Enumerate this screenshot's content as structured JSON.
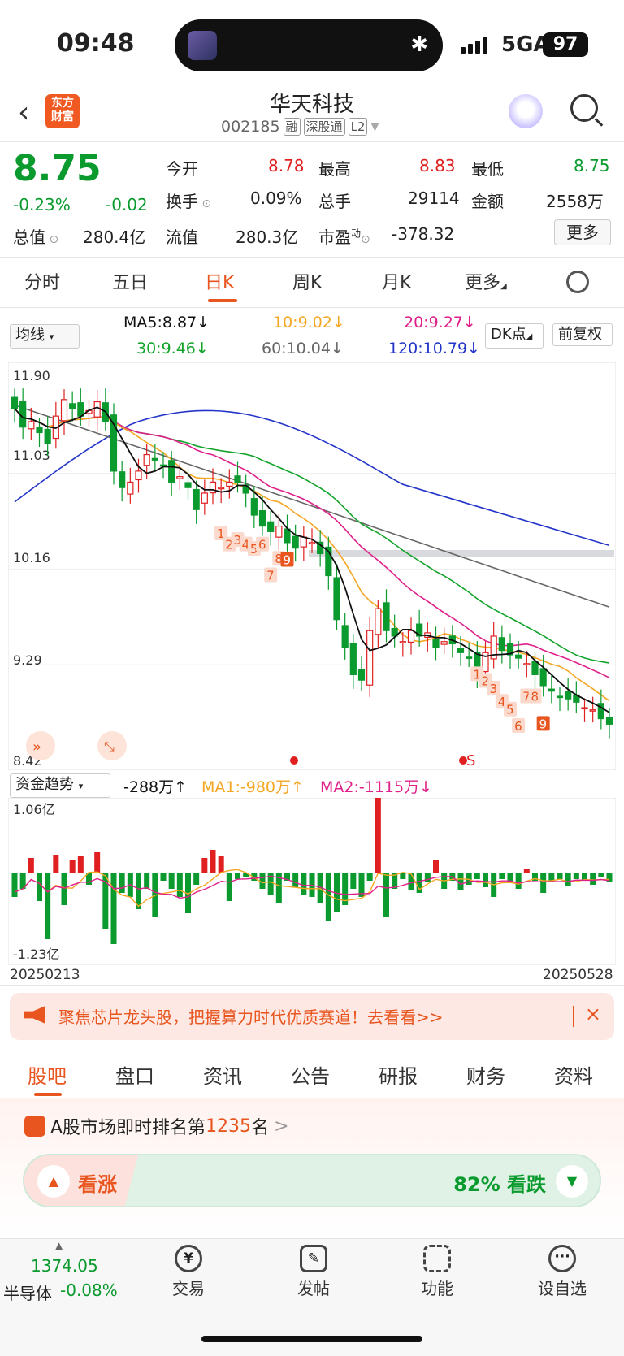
{
  "status": {
    "time": "09:48",
    "network": "5GA",
    "battery": "97",
    "bluetooth_icon": "bluetooth-icon"
  },
  "header": {
    "app_logo": "东方财富",
    "title": "华天科技",
    "code": "002185",
    "tags": [
      "融",
      "深股通",
      "L2"
    ]
  },
  "quote": {
    "price": "8.75",
    "change_pct": "-0.23%",
    "change": "-0.02",
    "open_label": "今开",
    "open": "8.78",
    "high_label": "最高",
    "high": "8.83",
    "low_label": "最低",
    "low": "8.75",
    "turnover_label": "换手",
    "turnover": "0.09%",
    "volume_label": "总手",
    "volume": "29114",
    "amount_label": "金额",
    "amount": "2558万",
    "mktcap_label": "总值",
    "mktcap": "280.4亿",
    "float_label": "流值",
    "float": "280.3亿",
    "pe_label": "市盈",
    "pe_sup": "动",
    "pe": "-378.32",
    "more": "更多"
  },
  "period_tabs": [
    "分时",
    "五日",
    "日K",
    "周K",
    "月K",
    "更多"
  ],
  "ma": {
    "selector": "均线",
    "ma5": "MA5:8.87↓",
    "ma10": "10:9.02↓",
    "ma20": "20:9.27↓",
    "ma30": "30:9.46↓",
    "ma60": "60:10.04↓",
    "ma120": "120:10.79↓",
    "dk": "DK点",
    "adjust": "前复权",
    "colors": {
      "ma5": "#111111",
      "ma10": "#f5a623",
      "ma20": "#e0208a",
      "ma30": "#12a32a",
      "ma60": "#666666",
      "ma120": "#2335c8"
    }
  },
  "kline": {
    "y_labels": [
      "11.90",
      "11.03",
      "10.16",
      "9.29",
      "8.42"
    ],
    "date_start": "20250213",
    "date_end": "20250528",
    "signal_label": "S"
  },
  "flow": {
    "selector": "资金趋势",
    "value": "-288万↑",
    "ma1": "MA1:-980万↑",
    "ma2": "MA2:-1115万↓",
    "y_top": "1.06亿",
    "y_bottom": "-1.23亿"
  },
  "ad": {
    "text": "聚焦芯片龙头股，把握算力时代优质赛道！去看看>>",
    "close": "×"
  },
  "content_tabs": [
    "股吧",
    "盘口",
    "资讯",
    "公告",
    "研报",
    "财务",
    "资料"
  ],
  "rank": {
    "prefix": "A股市场即时排名第",
    "num": "1235",
    "suffix": "名",
    "arrow": ">"
  },
  "vote": {
    "up_label": "看涨",
    "down_pct": "82%",
    "down_label": "看跌",
    "down_share": 0.82
  },
  "bottom": {
    "index_value": "1374.05",
    "index_name": "半导体",
    "index_change": "-0.08%",
    "items": [
      "交易",
      "发帖",
      "功能",
      "设自选"
    ]
  }
}
